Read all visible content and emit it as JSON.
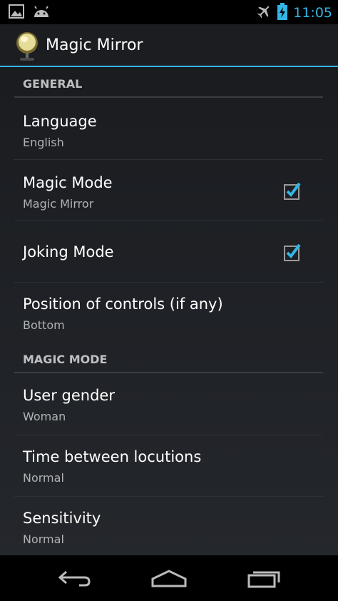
{
  "status_bar": {
    "time": "11:05",
    "icons": [
      "gallery-icon",
      "android-icon",
      "airplane-icon",
      "battery-charging-icon"
    ]
  },
  "action_bar": {
    "title": "Magic Mirror",
    "icon": "mirror-icon"
  },
  "sections": [
    {
      "header": "GENERAL",
      "items": [
        {
          "title": "Language",
          "summary": "English"
        },
        {
          "title": "Magic Mode",
          "summary": "Magic Mirror",
          "checked": true
        },
        {
          "title": "Joking Mode",
          "checked": true
        },
        {
          "title": "Position of controls (if any)",
          "summary": "Bottom"
        }
      ]
    },
    {
      "header": "MAGIC MODE",
      "items": [
        {
          "title": "User gender",
          "summary": "Woman"
        },
        {
          "title": "Time between locutions",
          "summary": "Normal"
        },
        {
          "title": "Sensitivity",
          "summary": "Normal"
        }
      ]
    }
  ],
  "nav_bar": {
    "buttons": [
      "back-icon",
      "home-icon",
      "recent-apps-icon"
    ]
  },
  "colors": {
    "accent": "#33b5e5",
    "background": "#1a1c20",
    "divider": "#3a3d41"
  }
}
